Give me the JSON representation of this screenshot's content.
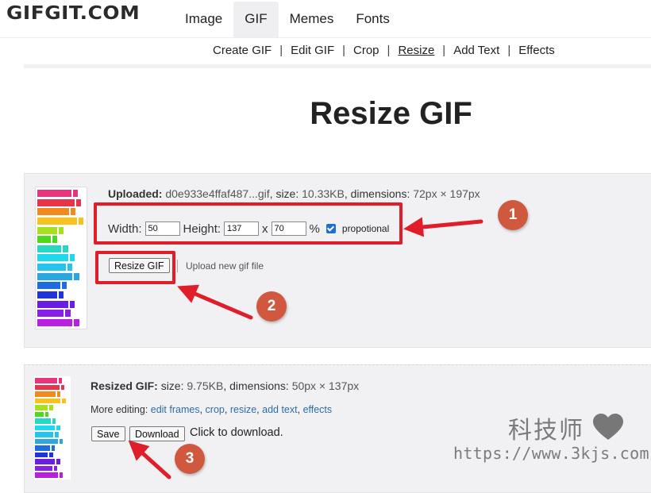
{
  "header": {
    "logo": "GIFGIT.COM",
    "nav": [
      {
        "label": "Image",
        "active": false
      },
      {
        "label": "GIF",
        "active": true
      },
      {
        "label": "Memes",
        "active": false
      },
      {
        "label": "Fonts",
        "active": false
      }
    ]
  },
  "subnav": {
    "items": [
      {
        "label": "Create GIF",
        "current": false
      },
      {
        "label": "Edit GIF",
        "current": false
      },
      {
        "label": "Crop",
        "current": false
      },
      {
        "label": "Resize",
        "current": true
      },
      {
        "label": "Add Text",
        "current": false
      },
      {
        "label": "Effects",
        "current": false
      }
    ],
    "separator": "|"
  },
  "page_title": "Resize GIF",
  "upload": {
    "label": "Uploaded:",
    "filename": "d0e933e4ffaf487...gif",
    "size_label": "size:",
    "size": "10.33KB",
    "dimensions_label": "dimensions:",
    "dimensions": "72px × 197px",
    "form": {
      "width_label": "Width:",
      "width_value": "50",
      "height_label": "Height:",
      "height_value": "137",
      "times": "x",
      "percent_value": "70",
      "percent_sign": "%",
      "proportional_checked": true,
      "proportional_label": "propotional"
    },
    "resize_button": "Resize GIF",
    "upload_new_link": "Upload new gif file"
  },
  "result": {
    "label": "Resized GIF:",
    "size_label": "size:",
    "size": "9.75KB",
    "dimensions_label": "dimensions:",
    "dimensions": "50px × 137px",
    "more_editing_label": "More editing:",
    "more_links": [
      "edit frames",
      "crop",
      "resize",
      "add text",
      "effects"
    ],
    "save_button": "Save",
    "download_button": "Download",
    "download_hint": "Click to download."
  },
  "thumbnail_bar_colors": [
    "#e8347c",
    "#e8344a",
    "#f08a1c",
    "#f5c21f",
    "#a8e01e",
    "#4cd81c",
    "#26d8c4",
    "#1ed8ec",
    "#26c4ec",
    "#2aa6e0",
    "#1f6ce0",
    "#1f34d8",
    "#6a1fe0",
    "#8a1fe8",
    "#b81fe0"
  ],
  "annotations": {
    "color": "#e01e2a",
    "badge_color": "#d0583e",
    "steps": [
      "1",
      "2",
      "3"
    ]
  },
  "watermark": {
    "title": "科技师",
    "url": "https://www.3kjs.com"
  }
}
